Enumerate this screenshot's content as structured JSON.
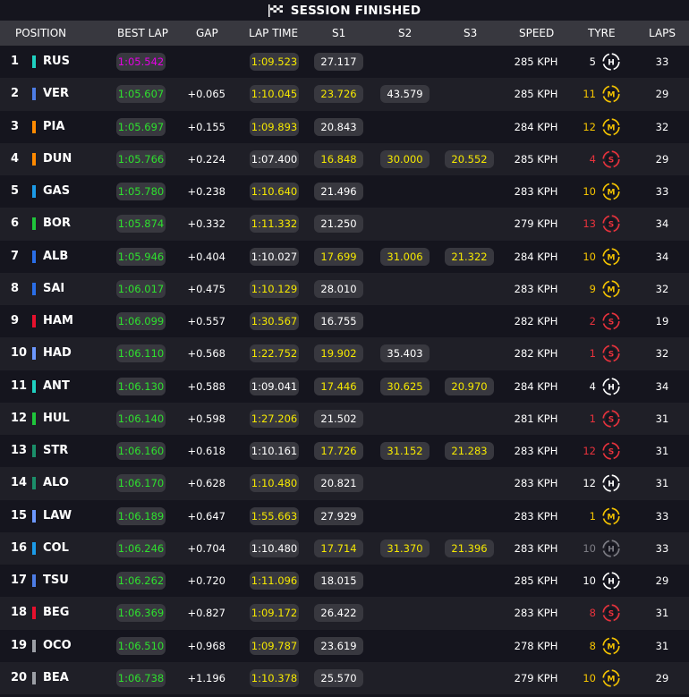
{
  "banner": {
    "title": "SESSION FINISHED",
    "icon": "chequered-flag-icon"
  },
  "columns": [
    "POSITION",
    "BEST LAP",
    "GAP",
    "LAP TIME",
    "S1",
    "S2",
    "S3",
    "SPEED",
    "TYRE",
    "LAPS"
  ],
  "colors": {
    "background": "#15151e",
    "row_alt": "#1f1f27",
    "header": "#38383f",
    "pill": "#38383f",
    "personal_best": "#2ee02e",
    "overall_best": "#e400e4",
    "improved": "#f5e800",
    "tyre_soft": "#e8323c",
    "tyre_medium": "#f5c400",
    "tyre_hard": "#ffffff",
    "tyre_hard_used": "#7d7d85"
  },
  "rows": [
    {
      "pos": "1",
      "code": "RUS",
      "team": "#1fd1c1",
      "best": "1:05.542",
      "best_color": "purple",
      "gap": "",
      "lap": "1:09.523",
      "lap_color": "yellow",
      "s1": "27.117",
      "s1_color": "white",
      "s2": "",
      "s2_color": "white",
      "s3": "",
      "s3_color": "white",
      "speed": "285 KPH",
      "tyre_age": "5",
      "tyre": "H",
      "tyre_color": "hard",
      "laps": "33"
    },
    {
      "pos": "2",
      "code": "VER",
      "team": "#4d7de6",
      "best": "1:05.607",
      "best_color": "green",
      "gap": "+0.065",
      "lap": "1:10.045",
      "lap_color": "yellow",
      "s1": "23.726",
      "s1_color": "yellow",
      "s2": "43.579",
      "s2_color": "white",
      "s3": "",
      "s3_color": "white",
      "speed": "285 KPH",
      "tyre_age": "11",
      "tyre": "M",
      "tyre_color": "medium",
      "laps": "29"
    },
    {
      "pos": "3",
      "code": "PIA",
      "team": "#ff8a00",
      "best": "1:05.697",
      "best_color": "green",
      "gap": "+0.155",
      "lap": "1:09.893",
      "lap_color": "yellow",
      "s1": "20.843",
      "s1_color": "white",
      "s2": "",
      "s2_color": "white",
      "s3": "",
      "s3_color": "white",
      "speed": "284 KPH",
      "tyre_age": "12",
      "tyre": "M",
      "tyre_color": "medium",
      "laps": "32"
    },
    {
      "pos": "4",
      "code": "DUN",
      "team": "#ff8a00",
      "best": "1:05.766",
      "best_color": "green",
      "gap": "+0.224",
      "lap": "1:07.400",
      "lap_color": "white",
      "s1": "16.848",
      "s1_color": "yellow",
      "s2": "30.000",
      "s2_color": "yellow",
      "s3": "20.552",
      "s3_color": "yellow",
      "speed": "285 KPH",
      "tyre_age": "4",
      "tyre": "S",
      "tyre_color": "soft",
      "laps": "29"
    },
    {
      "pos": "5",
      "code": "GAS",
      "team": "#1c9be8",
      "best": "1:05.780",
      "best_color": "green",
      "gap": "+0.238",
      "lap": "1:10.640",
      "lap_color": "yellow",
      "s1": "21.496",
      "s1_color": "white",
      "s2": "",
      "s2_color": "white",
      "s3": "",
      "s3_color": "white",
      "speed": "283 KPH",
      "tyre_age": "10",
      "tyre": "M",
      "tyre_color": "medium",
      "laps": "33"
    },
    {
      "pos": "6",
      "code": "BOR",
      "team": "#1fc63b",
      "best": "1:05.874",
      "best_color": "green",
      "gap": "+0.332",
      "lap": "1:11.332",
      "lap_color": "yellow",
      "s1": "21.250",
      "s1_color": "white",
      "s2": "",
      "s2_color": "white",
      "s3": "",
      "s3_color": "white",
      "speed": "279 KPH",
      "tyre_age": "13",
      "tyre": "S",
      "tyre_color": "soft",
      "laps": "34"
    },
    {
      "pos": "7",
      "code": "ALB",
      "team": "#2a6ee8",
      "best": "1:05.946",
      "best_color": "green",
      "gap": "+0.404",
      "lap": "1:10.027",
      "lap_color": "white",
      "s1": "17.699",
      "s1_color": "yellow",
      "s2": "31.006",
      "s2_color": "yellow",
      "s3": "21.322",
      "s3_color": "yellow",
      "speed": "284 KPH",
      "tyre_age": "10",
      "tyre": "M",
      "tyre_color": "medium",
      "laps": "34"
    },
    {
      "pos": "8",
      "code": "SAI",
      "team": "#2a6ee8",
      "best": "1:06.017",
      "best_color": "green",
      "gap": "+0.475",
      "lap": "1:10.129",
      "lap_color": "yellow",
      "s1": "28.010",
      "s1_color": "white",
      "s2": "",
      "s2_color": "white",
      "s3": "",
      "s3_color": "white",
      "speed": "283 KPH",
      "tyre_age": "9",
      "tyre": "M",
      "tyre_color": "medium",
      "laps": "32"
    },
    {
      "pos": "9",
      "code": "HAM",
      "team": "#e8102d",
      "best": "1:06.099",
      "best_color": "green",
      "gap": "+0.557",
      "lap": "1:30.567",
      "lap_color": "yellow",
      "s1": "16.755",
      "s1_color": "white",
      "s2": "",
      "s2_color": "white",
      "s3": "",
      "s3_color": "white",
      "speed": "282 KPH",
      "tyre_age": "2",
      "tyre": "S",
      "tyre_color": "soft",
      "laps": "19"
    },
    {
      "pos": "10",
      "code": "HAD",
      "team": "#6c98ff",
      "best": "1:06.110",
      "best_color": "green",
      "gap": "+0.568",
      "lap": "1:22.752",
      "lap_color": "yellow",
      "s1": "19.902",
      "s1_color": "yellow",
      "s2": "35.403",
      "s2_color": "white",
      "s3": "",
      "s3_color": "white",
      "speed": "282 KPH",
      "tyre_age": "1",
      "tyre": "S",
      "tyre_color": "soft",
      "laps": "32"
    },
    {
      "pos": "11",
      "code": "ANT",
      "team": "#1fd1c1",
      "best": "1:06.130",
      "best_color": "green",
      "gap": "+0.588",
      "lap": "1:09.041",
      "lap_color": "white",
      "s1": "17.446",
      "s1_color": "yellow",
      "s2": "30.625",
      "s2_color": "yellow",
      "s3": "20.970",
      "s3_color": "yellow",
      "speed": "284 KPH",
      "tyre_age": "4",
      "tyre": "H",
      "tyre_color": "hard",
      "laps": "34"
    },
    {
      "pos": "12",
      "code": "HUL",
      "team": "#1fc63b",
      "best": "1:06.140",
      "best_color": "green",
      "gap": "+0.598",
      "lap": "1:27.206",
      "lap_color": "yellow",
      "s1": "21.502",
      "s1_color": "white",
      "s2": "",
      "s2_color": "white",
      "s3": "",
      "s3_color": "white",
      "speed": "281 KPH",
      "tyre_age": "1",
      "tyre": "S",
      "tyre_color": "soft",
      "laps": "31"
    },
    {
      "pos": "13",
      "code": "STR",
      "team": "#1b8f6a",
      "best": "1:06.160",
      "best_color": "green",
      "gap": "+0.618",
      "lap": "1:10.161",
      "lap_color": "white",
      "s1": "17.726",
      "s1_color": "yellow",
      "s2": "31.152",
      "s2_color": "yellow",
      "s3": "21.283",
      "s3_color": "yellow",
      "speed": "283 KPH",
      "tyre_age": "12",
      "tyre": "S",
      "tyre_color": "soft",
      "laps": "31"
    },
    {
      "pos": "14",
      "code": "ALO",
      "team": "#1b8f6a",
      "best": "1:06.170",
      "best_color": "green",
      "gap": "+0.628",
      "lap": "1:10.480",
      "lap_color": "yellow",
      "s1": "20.821",
      "s1_color": "white",
      "s2": "",
      "s2_color": "white",
      "s3": "",
      "s3_color": "white",
      "speed": "283 KPH",
      "tyre_age": "12",
      "tyre": "H",
      "tyre_color": "hard",
      "laps": "31"
    },
    {
      "pos": "15",
      "code": "LAW",
      "team": "#6c98ff",
      "best": "1:06.189",
      "best_color": "green",
      "gap": "+0.647",
      "lap": "1:55.663",
      "lap_color": "yellow",
      "s1": "27.929",
      "s1_color": "white",
      "s2": "",
      "s2_color": "white",
      "s3": "",
      "s3_color": "white",
      "speed": "283 KPH",
      "tyre_age": "1",
      "tyre": "M",
      "tyre_color": "medium",
      "laps": "33"
    },
    {
      "pos": "16",
      "code": "COL",
      "team": "#1c9be8",
      "best": "1:06.246",
      "best_color": "green",
      "gap": "+0.704",
      "lap": "1:10.480",
      "lap_color": "white",
      "s1": "17.714",
      "s1_color": "yellow",
      "s2": "31.370",
      "s2_color": "yellow",
      "s3": "21.396",
      "s3_color": "yellow",
      "speed": "283 KPH",
      "tyre_age": "10",
      "tyre": "H",
      "tyre_color": "hard_used",
      "laps": "33"
    },
    {
      "pos": "17",
      "code": "TSU",
      "team": "#4d7de6",
      "best": "1:06.262",
      "best_color": "green",
      "gap": "+0.720",
      "lap": "1:11.096",
      "lap_color": "yellow",
      "s1": "18.015",
      "s1_color": "white",
      "s2": "",
      "s2_color": "white",
      "s3": "",
      "s3_color": "white",
      "speed": "285 KPH",
      "tyre_age": "10",
      "tyre": "H",
      "tyre_color": "hard",
      "laps": "29"
    },
    {
      "pos": "18",
      "code": "BEG",
      "team": "#e8102d",
      "best": "1:06.369",
      "best_color": "green",
      "gap": "+0.827",
      "lap": "1:09.172",
      "lap_color": "yellow",
      "s1": "26.422",
      "s1_color": "white",
      "s2": "",
      "s2_color": "white",
      "s3": "",
      "s3_color": "white",
      "speed": "283 KPH",
      "tyre_age": "8",
      "tyre": "S",
      "tyre_color": "soft",
      "laps": "31"
    },
    {
      "pos": "19",
      "code": "OCO",
      "team": "#9c9fa6",
      "best": "1:06.510",
      "best_color": "green",
      "gap": "+0.968",
      "lap": "1:09.787",
      "lap_color": "yellow",
      "s1": "23.619",
      "s1_color": "white",
      "s2": "",
      "s2_color": "white",
      "s3": "",
      "s3_color": "white",
      "speed": "278 KPH",
      "tyre_age": "8",
      "tyre": "M",
      "tyre_color": "medium",
      "laps": "31"
    },
    {
      "pos": "20",
      "code": "BEA",
      "team": "#9c9fa6",
      "best": "1:06.738",
      "best_color": "green",
      "gap": "+1.196",
      "lap": "1:10.378",
      "lap_color": "yellow",
      "s1": "25.570",
      "s1_color": "white",
      "s2": "",
      "s2_color": "white",
      "s3": "",
      "s3_color": "white",
      "speed": "279 KPH",
      "tyre_age": "10",
      "tyre": "M",
      "tyre_color": "medium",
      "laps": "29"
    }
  ]
}
